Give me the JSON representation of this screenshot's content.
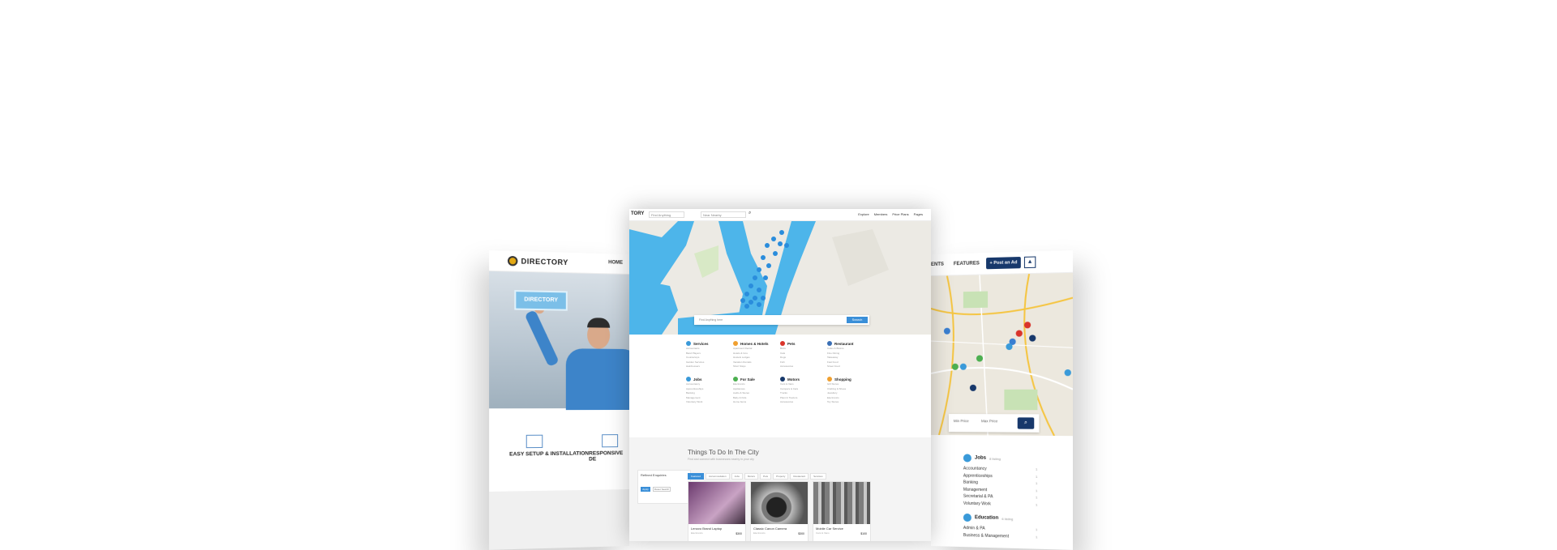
{
  "left_screen": {
    "brand": "DIRECTORY",
    "nav_home": "HOME",
    "hero_badge": "DIRECTORY",
    "feature_1": "EASY SETUP & INSTALLATION",
    "feature_2": "RESPONSIVE DE"
  },
  "center_screen": {
    "brand": "TORY",
    "search_what_placeholder": "Find Anything",
    "search_where_placeholder": "Near Nearby",
    "menu": [
      "Explore",
      "Members",
      "Price Plans",
      "Pages"
    ],
    "map_search_placeholder": "Find Anything here",
    "map_search_button": "Search",
    "categories": [
      {
        "name": "Services",
        "color": "#3a9ad9",
        "items": [
          "Accountants",
          "Band Players",
          "Countertops",
          "Garden Services",
          "Hairdressers"
        ]
      },
      {
        "name": "Homes & Hotels",
        "color": "#f0a030",
        "items": [
          "Apartment Rental",
          "Hotels & Inns",
          "Hostels Lodges",
          "Vacation Rentals",
          "Short Stays"
        ]
      },
      {
        "name": "Pets",
        "color": "#d9342b",
        "items": [
          "Birds",
          "Cats",
          "Dogs",
          "Fish",
          "Accessories"
        ]
      },
      {
        "name": "Restaurant",
        "color": "#3a6fb5",
        "items": [
          "Cafes & Bistros",
          "Fine Dining",
          "Takeaway",
          "Fast Food",
          "Street Food"
        ]
      },
      {
        "name": "Jobs",
        "color": "#3a9ad9",
        "items": [
          "Accountancy",
          "Apprenticeships",
          "Banking",
          "Management",
          "Voluntary Work"
        ]
      },
      {
        "name": "For Sale",
        "color": "#4caf50",
        "items": [
          "Electronics",
          "Appliances",
          "Audio & Stereo",
          "Baby & Kids",
          "Home Items"
        ]
      },
      {
        "name": "Motors",
        "color": "#17386b",
        "items": [
          "Cars & Vans",
          "Campers & Cars",
          "Trucks",
          "Plant & Tractors",
          "Accessories"
        ]
      },
      {
        "name": "Shopping",
        "color": "#f0a030",
        "items": [
          "Gift Stores",
          "Clothing & Shoes",
          "Jewellery",
          "Electronics",
          "Toy Stores"
        ]
      }
    ],
    "things_title": "Things To Do In The City",
    "things_sub": "Find and connect with businesses nearby in your city",
    "sidebar_title": "Refined Enquiries",
    "sidebar_btn_1": "Apply",
    "sidebar_btn_2": "Reset Search",
    "tabs": [
      "Featured",
      "Accommodation",
      "Jobs",
      "Motors",
      "Pets",
      "Property",
      "Restaurant",
      "Services"
    ],
    "cards": [
      {
        "title": "Lenovo Brand Laptop",
        "price": "$300",
        "meta": "Electronics"
      },
      {
        "title": "Classic Canon Camera",
        "price": "$300",
        "meta": "Electronics"
      },
      {
        "title": "Mobile Car Service",
        "price": "$100",
        "meta": "Cars & Vans"
      }
    ]
  },
  "right_screen": {
    "nav_agents": "ENTS",
    "nav_features": "FEATURES",
    "post_ad": "+ Post an Ad",
    "min_price": "Min Price",
    "max_price": "Max Price",
    "jobs_title": "Jobs",
    "jobs_count": "8 listing",
    "jobs_items": [
      {
        "label": "Accountancy",
        "n": "1"
      },
      {
        "label": "Apprenticeships",
        "n": "1"
      },
      {
        "label": "Banking",
        "n": "1"
      },
      {
        "label": "Management",
        "n": "1"
      },
      {
        "label": "Secretarial & PA",
        "n": "1"
      },
      {
        "label": "Voluntary Work",
        "n": "1"
      }
    ],
    "edu_title": "Education",
    "edu_count": "6 listing",
    "edu_items": [
      {
        "label": "Admin & PA",
        "n": "1"
      },
      {
        "label": "Business & Management",
        "n": "1"
      }
    ]
  }
}
